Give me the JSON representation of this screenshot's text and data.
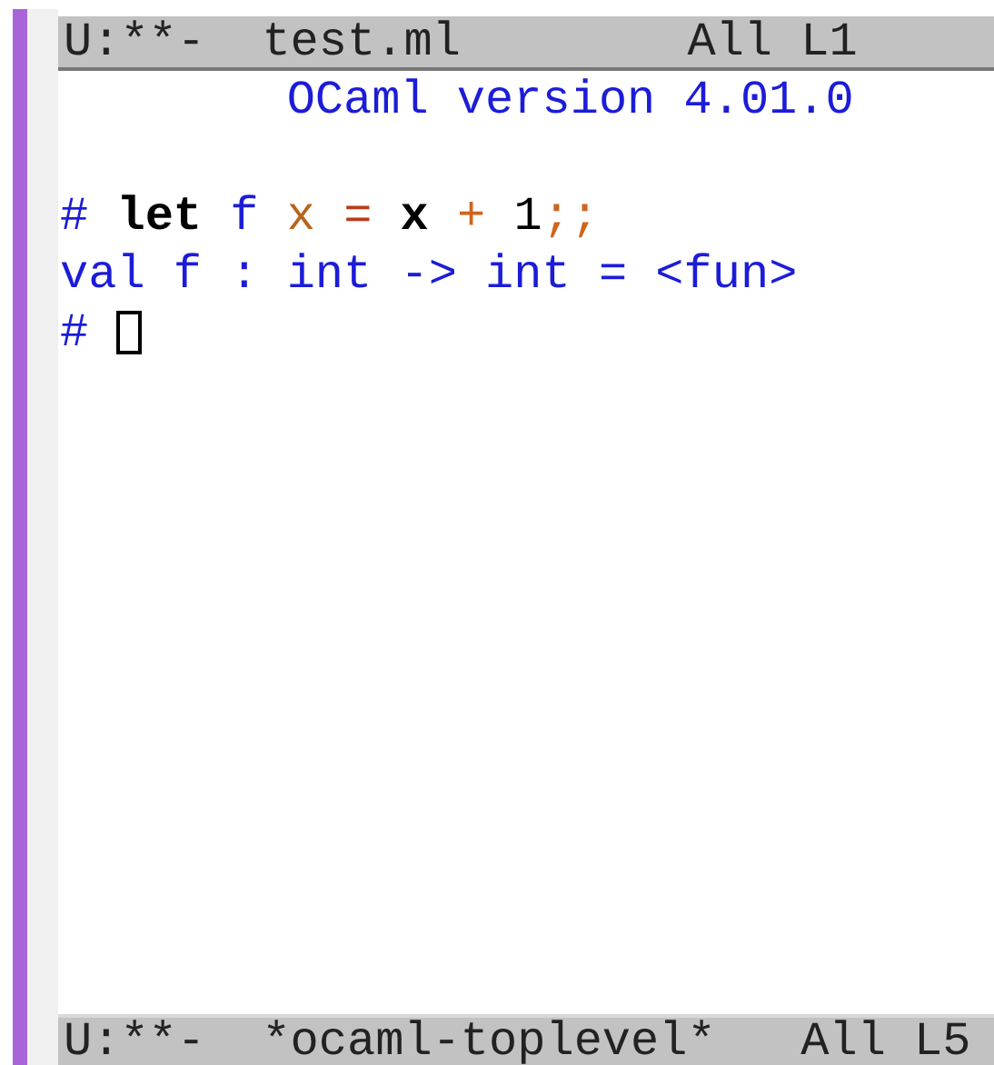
{
  "top_mode_line": {
    "status": "U:**-",
    "buffer": "test.ml",
    "position": "All L1"
  },
  "banner": "OCaml version 4.01.0",
  "lines": [
    {
      "tokens": [
        {
          "text": "# ",
          "kind": "prompt"
        },
        {
          "text": "let ",
          "kind": "keyword"
        },
        {
          "text": "f ",
          "kind": "function"
        },
        {
          "text": "x ",
          "kind": "variable"
        },
        {
          "text": "= ",
          "kind": "operator"
        },
        {
          "text": "x ",
          "kind": "keyword"
        },
        {
          "text": "+ ",
          "kind": "punct"
        },
        {
          "text": "1",
          "kind": "plain"
        },
        {
          "text": ";;",
          "kind": "punct"
        }
      ]
    },
    {
      "tokens": [
        {
          "text": "val f : int -> int = <fun>",
          "kind": "output"
        }
      ]
    },
    {
      "tokens": [
        {
          "text": "# ",
          "kind": "prompt"
        }
      ],
      "cursor": true
    }
  ],
  "bottom_mode_line": {
    "status": "U:**-",
    "buffer": "*ocaml-toplevel*",
    "position": "All L5"
  }
}
